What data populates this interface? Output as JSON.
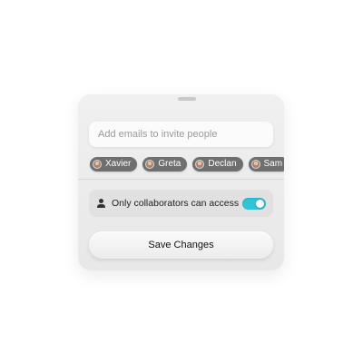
{
  "invite": {
    "placeholder": "Add emails to invite people"
  },
  "collaborators": [
    {
      "name": "Xavier",
      "avatar": "avatar-photo"
    },
    {
      "name": "Greta",
      "avatar": "avatar-photo"
    },
    {
      "name": "Declan",
      "avatar": "avatar-photo"
    },
    {
      "name": "Sam",
      "avatar": "avatar-photo"
    },
    {
      "name": "",
      "avatar": "avatar-photo"
    }
  ],
  "access": {
    "label": "Only collaborators can access",
    "icon": "person-icon",
    "enabled": true,
    "toggle_color": "#2fc4d6"
  },
  "actions": {
    "save_label": "Save Changes"
  }
}
